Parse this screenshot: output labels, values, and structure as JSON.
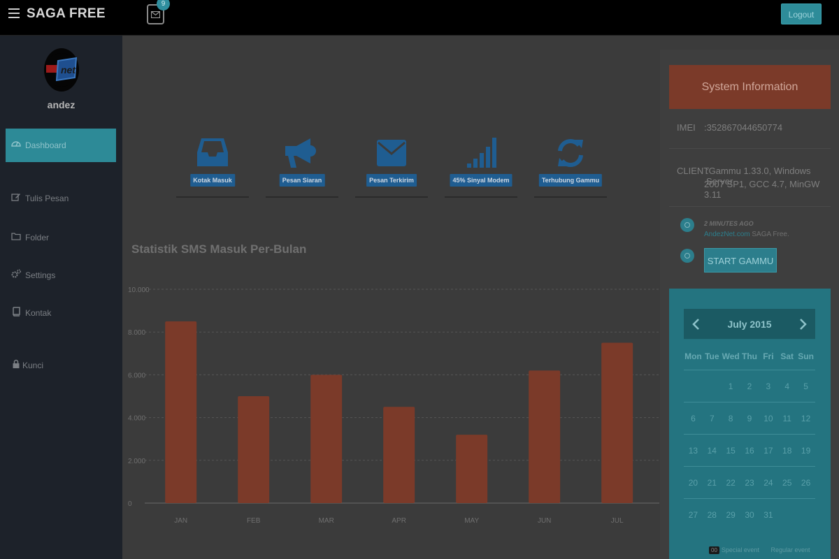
{
  "app": {
    "brand": "SAGA FREE",
    "mail_badge": "9",
    "logout_label": "Logout"
  },
  "user": {
    "name": "andez",
    "avatar_icon": "andeznet-logo"
  },
  "sidebar": {
    "items": [
      {
        "label": "Dashboard",
        "icon": "dashboard-icon",
        "active": true
      },
      {
        "label": "Tulis Pesan",
        "icon": "edit-icon",
        "active": false
      },
      {
        "label": "Folder",
        "icon": "folder-icon",
        "active": false
      },
      {
        "label": "Settings",
        "icon": "cogs-icon",
        "active": false
      },
      {
        "label": "Kontak",
        "icon": "book-icon",
        "active": false
      },
      {
        "label": "Kunci",
        "icon": "lock-icon",
        "active": false
      }
    ]
  },
  "tiles": [
    {
      "label": "Kotak Masuk",
      "icon": "inbox-icon"
    },
    {
      "label": "Pesan Siaran",
      "icon": "bullhorn-icon"
    },
    {
      "label": "Pesan Terkirim",
      "icon": "envelope-icon"
    },
    {
      "label": "45% Sinyal Modem",
      "icon": "signal-icon"
    },
    {
      "label": "Terhubung Gammu",
      "icon": "refresh-icon"
    }
  ],
  "chart_title": "Statistik SMS Masuk Per-Bulan",
  "chart_data": {
    "type": "bar",
    "categories": [
      "JAN",
      "FEB",
      "MAR",
      "APR",
      "MAY",
      "JUN",
      "JUL"
    ],
    "values": [
      8500,
      5000,
      6000,
      4500,
      3200,
      6200,
      7500
    ],
    "ylim": [
      0,
      10000
    ],
    "yticks": [
      "0",
      "2.000",
      "4.000",
      "6.000",
      "8.000",
      "10.000"
    ],
    "grid": true,
    "bar_color": "#7b3a29"
  },
  "system": {
    "header": "System Information",
    "imei_label": "IMEI",
    "imei_value": ":352867044650774",
    "client_label": "CLIENT",
    "client_line1": ":Gammu 1.33.0, Windows Server",
    "client_line2": "2007 SP1, GCC 4.7, MinGW 3.11",
    "activity_time": "2 MINUTES AGO",
    "activity_link": "AndezNet.com",
    "activity_text": " SAGA Free.",
    "start_button": "START GAMMU"
  },
  "calendar": {
    "title": "July 2015",
    "days": [
      "Mon",
      "Tue",
      "Wed",
      "Thu",
      "Fri",
      "Sat",
      "Sun"
    ],
    "weeks": [
      [
        "",
        "",
        "1",
        "2",
        "3",
        "4",
        "5"
      ],
      [
        "6",
        "7",
        "8",
        "9",
        "10",
        "11",
        "12"
      ],
      [
        "13",
        "14",
        "15",
        "16",
        "17",
        "18",
        "19"
      ],
      [
        "20",
        "21",
        "22",
        "23",
        "24",
        "25",
        "26"
      ],
      [
        "27",
        "28",
        "29",
        "30",
        "31",
        "",
        ""
      ]
    ],
    "legend_badge": "00",
    "legend_special": "Special event",
    "legend_regular": "Regular event"
  }
}
